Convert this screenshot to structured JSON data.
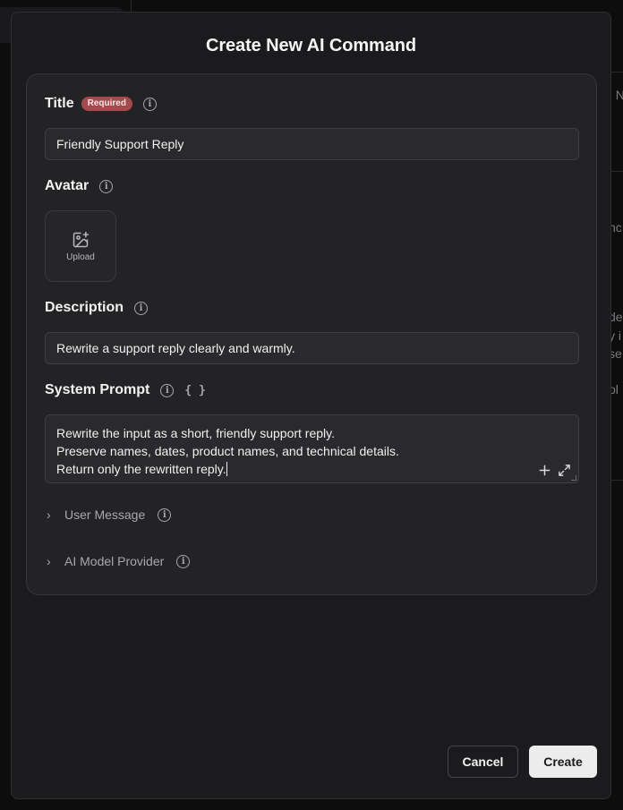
{
  "background": {
    "fragments": [
      "I N",
      "nc",
      "de",
      "y i",
      "se",
      "ol"
    ]
  },
  "dialog": {
    "title": "Create New AI Command"
  },
  "form": {
    "title": {
      "label": "Title",
      "required_badge": "Required",
      "value": "Friendly Support Reply"
    },
    "avatar": {
      "label": "Avatar",
      "upload_label": "Upload",
      "icon": "image-plus-icon"
    },
    "description": {
      "label": "Description",
      "value": "Rewrite a support reply clearly and warmly."
    },
    "system_prompt": {
      "label": "System Prompt",
      "variables_icon": "{ }",
      "lines": [
        "Rewrite the input as a short, friendly support reply.",
        "Preserve names, dates, product names, and technical details.",
        "Return only the rewritten reply."
      ]
    },
    "user_message": {
      "label": "User Message"
    },
    "ai_model_provider": {
      "label": "AI Model Provider"
    }
  },
  "actions": {
    "cancel_label": "Cancel",
    "create_label": "Create"
  },
  "colors": {
    "required_badge": "#a54a4c",
    "primary_button": "#ececec",
    "dialog_bg": "#1b1b1d"
  }
}
